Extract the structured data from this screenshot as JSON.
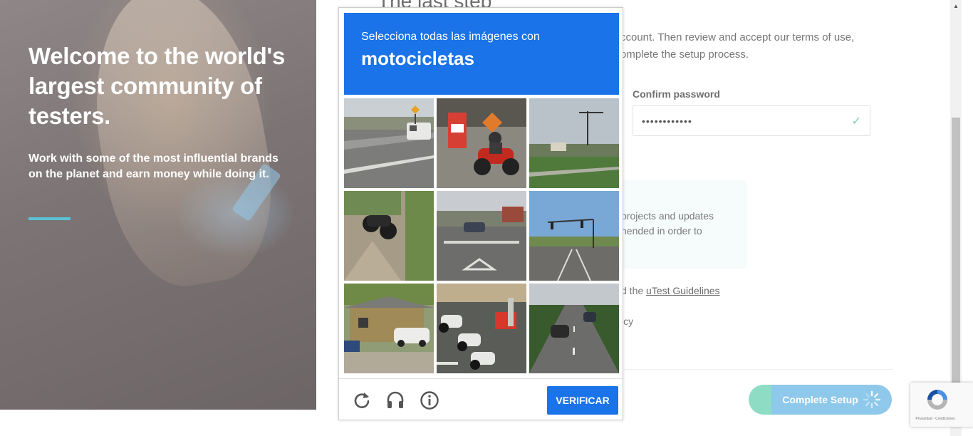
{
  "hero": {
    "title": "Welcome to the world's largest community of testers.",
    "subtitle": "Work with some of the most influential brands on the planet and earn money while doing it."
  },
  "form": {
    "heading": "The last step",
    "intro": "ccount. Then review and accept our terms of use, omplete the setup process.",
    "confirm_label": "Confirm password",
    "confirm_value": "••••••••••••",
    "info_text": "projects and updates nended in order to",
    "guidelines_prefix": "d the ",
    "guidelines_link": "uTest Guidelines",
    "privacy_fragment": "icy",
    "complete_label": "Complete Setup"
  },
  "captcha": {
    "instruction": "Selecciona todas las imágenes con",
    "target": "motocicletas",
    "verify_label": "VERIFICAR",
    "tiles": [
      "highway-with-suv",
      "motorcycle-rider-with-red-signs",
      "grass-field-with-crane",
      "motorcycle-on-dirt-path",
      "street-intersection-with-car",
      "road-with-traffic-lights",
      "house-with-parked-car",
      "parked-motorcycles-on-sidewalk",
      "road-with-traffic"
    ],
    "icons": [
      "reload-icon",
      "audio-icon",
      "info-icon"
    ]
  },
  "badge": {
    "text": "Privacidad - Condiciones"
  },
  "colors": {
    "captcha_blue": "#1a73e8",
    "accent_teal": "#5bc2d6",
    "complete_green": "#8fdcc5",
    "complete_blue": "#8ec8ea"
  }
}
